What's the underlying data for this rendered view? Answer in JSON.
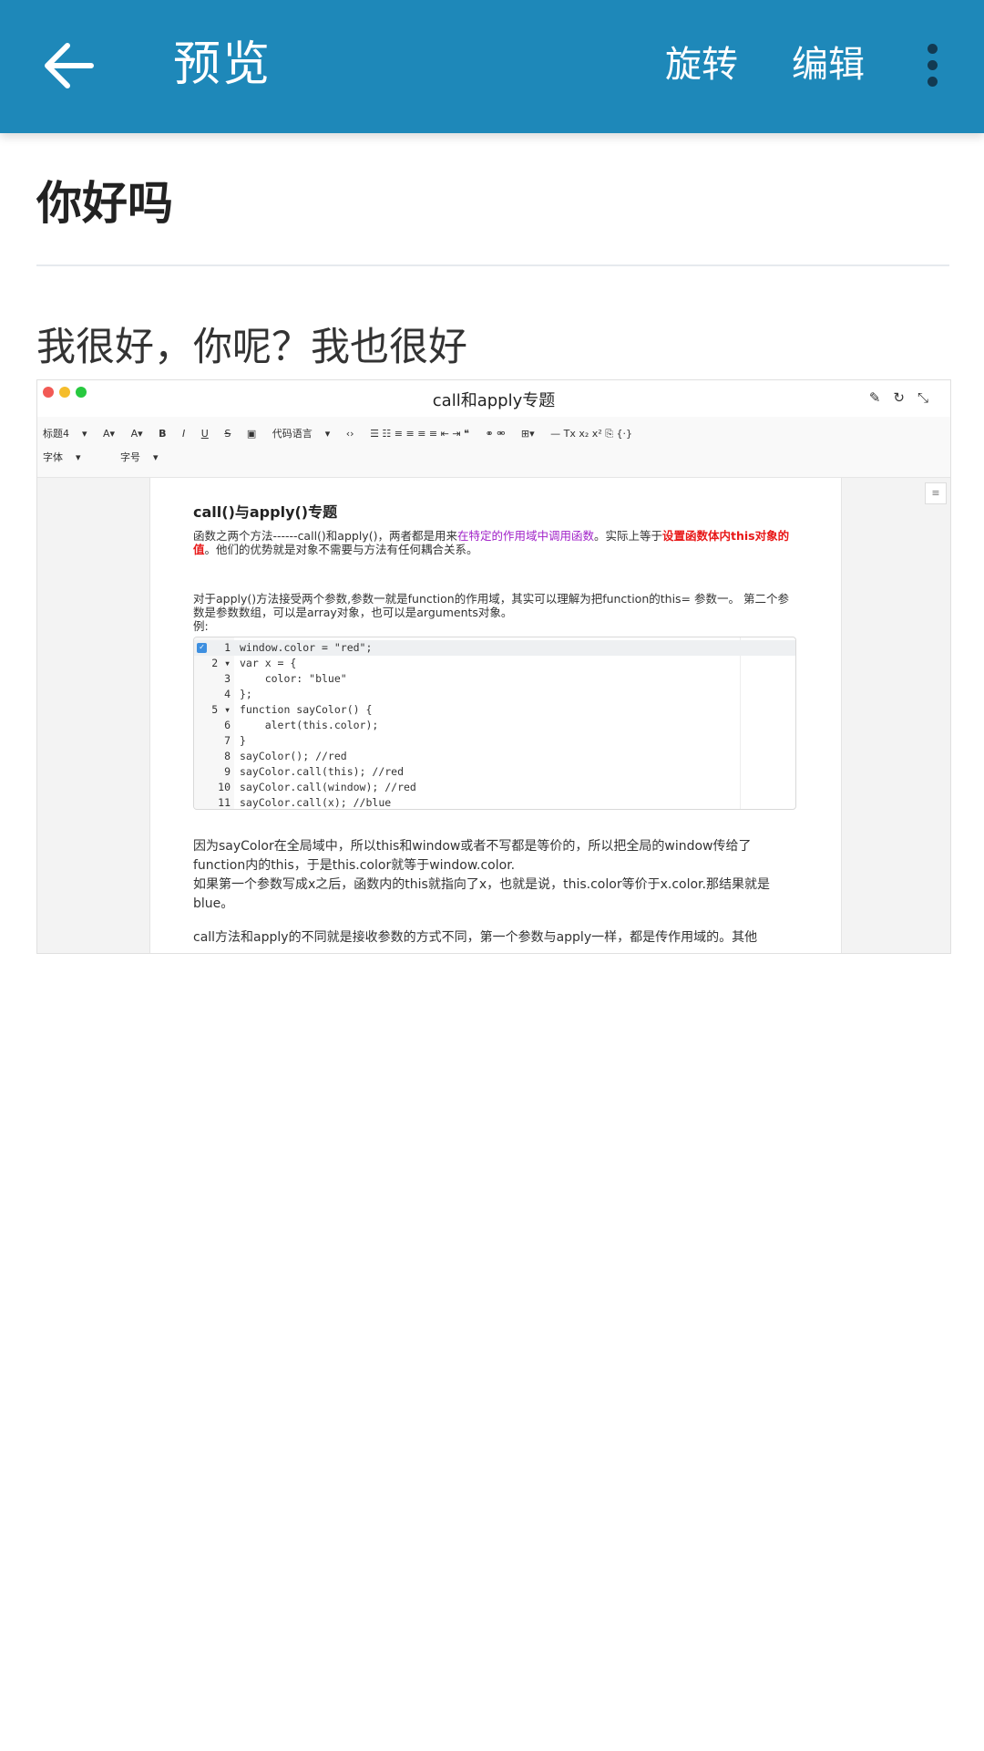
{
  "appbar": {
    "title": "预览",
    "actions": {
      "rotate": "旋转",
      "edit": "编辑"
    },
    "icons": {
      "back": "back-arrow-icon",
      "more": "more-vertical-icon"
    },
    "colors": {
      "background": "#1e88b9"
    }
  },
  "document": {
    "title": "你好吗",
    "body": "我很好，你呢？我也很好"
  },
  "embedded_screenshot": {
    "window_title": "call和apply专题",
    "toolbar": {
      "heading_select": "标题4",
      "code_language": "代码语言",
      "font_select": "字体",
      "size_select": "字号"
    },
    "heading": "call()与apply()专题",
    "para1_a": "函数之两个方法------call()和apply()，两者都是用来",
    "para1_purple": "在特定的作用域中调用函数",
    "para1_b": "。实际上等于",
    "para1_red": "设置函数体内this对象的值",
    "para1_c": "。他们的优势就是对象不需要与方法有任何耦合关系。",
    "para2": "对于apply()方法接受两个参数,参数一就是function的作用域，其实可以理解为把function的this= 参数一。 第二个参数是参数数组，可以是array对象，也可以是arguments对象。",
    "para2_b": "例:",
    "code_lines": [
      {
        "n": "1",
        "text": "window.color = \"red\";"
      },
      {
        "n": "2 ▾",
        "text": "var x = {"
      },
      {
        "n": "3",
        "text": "    color: \"blue\""
      },
      {
        "n": "4",
        "text": "};"
      },
      {
        "n": "5 ▾",
        "text": "function sayColor() {"
      },
      {
        "n": "6",
        "text": "    alert(this.color);"
      },
      {
        "n": "7",
        "text": "}"
      },
      {
        "n": "8",
        "text": "sayColor(); //red"
      },
      {
        "n": "9",
        "text": "sayColor.call(this); //red"
      },
      {
        "n": "10",
        "text": "sayColor.call(window); //red"
      },
      {
        "n": "11",
        "text": "sayColor.call(x); //blue"
      }
    ],
    "para3": "因为sayColor在全局域中，所以this和window或者不写都是等价的，所以把全局的window传给了function内的this，于是this.color就等于window.color.",
    "para3_b": "如果第一个参数写成x之后，函数内的this就指向了x，也就是说，this.color等价于x.color.那结果就是blue。",
    "para4": "call方法和apply的不同就是接收参数的方式不同，第一个参数与apply一样，都是传作用域的。其他"
  }
}
